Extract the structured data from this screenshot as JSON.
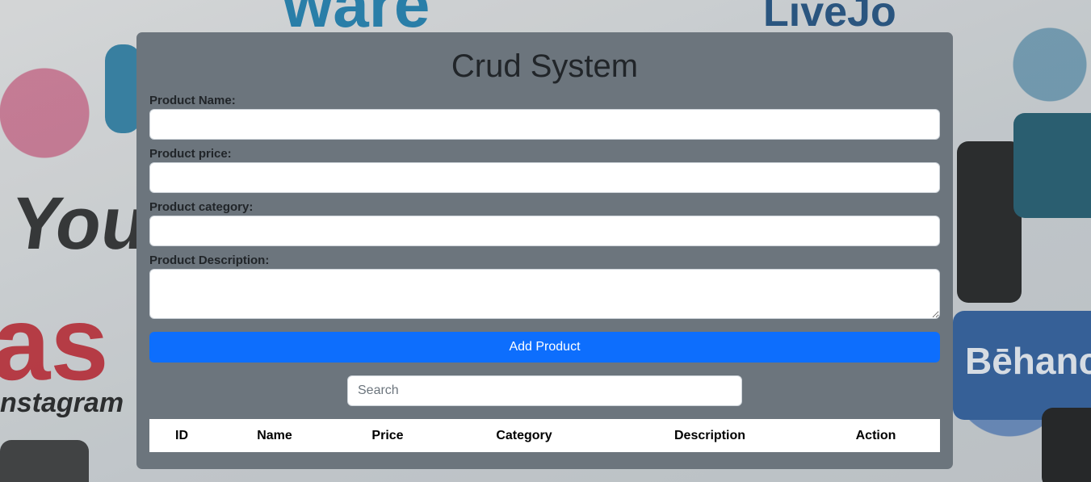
{
  "page": {
    "title": "Crud System"
  },
  "form": {
    "name_label": "Product Name:",
    "price_label": "Product price:",
    "category_label": "Product category:",
    "description_label": "Product Description:",
    "name_value": "",
    "price_value": "",
    "category_value": "",
    "description_value": ""
  },
  "actions": {
    "add_label": "Add Product"
  },
  "search": {
    "placeholder": "Search",
    "value": ""
  },
  "table": {
    "columns": [
      "ID",
      "Name",
      "Price",
      "Category",
      "Description",
      "Action"
    ],
    "rows": []
  },
  "colors": {
    "panel": "#6c757d",
    "primary": "#0d6efd",
    "text": "#212529"
  }
}
